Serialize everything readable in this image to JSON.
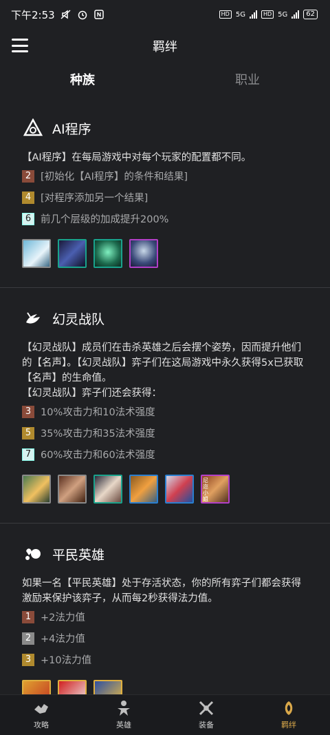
{
  "status": {
    "time": "下午2:53",
    "net1": "5G",
    "net2": "5G",
    "hd": "HD",
    "battery": "62"
  },
  "appbar": {
    "title": "羁绊"
  },
  "tabs": [
    {
      "label": "种族",
      "active": true
    },
    {
      "label": "职业",
      "active": false
    }
  ],
  "sections": [
    {
      "title": "AI程序",
      "desc": "【AI程序】在每局游戏中对每个玩家的配置都不同。",
      "tiers": [
        {
          "n": "2",
          "text": "[初始化【AI程序】的条件和结果]"
        },
        {
          "n": "4",
          "text": "[对程序添加另一个结果]"
        },
        {
          "n": "6",
          "text": "前几个层级的加成提升200%"
        }
      ],
      "champs": [
        "c1",
        "c2",
        "c2",
        "c4"
      ]
    },
    {
      "title": "幻灵战队",
      "desc": "【幻灵战队】成员们在击杀英雄之后会摆个姿势，因而提升他们的【名声】。【幻灵战队】弈子们在这局游戏中永久获得5x已获取【名声】的生命值。",
      "desc2": "【幻灵战队】弈子们还会获得：",
      "tiers": [
        {
          "n": "3",
          "text": "10%攻击力和10法术强度"
        },
        {
          "n": "5",
          "text": "35%攻击力和35法术强度"
        },
        {
          "n": "7",
          "text": "60%攻击力和60法术强度"
        }
      ],
      "champs": [
        "c1",
        "c1",
        "c2",
        "c3",
        "c3",
        "c4"
      ],
      "champ_label": "尼迩小姐"
    },
    {
      "title": "平民英雄",
      "desc": "如果一名【平民英雄】处于存活状态，你的所有弈子们都会获得激励来保护该弈子，从而每2秒获得法力值。",
      "tiers": [
        {
          "n": "1",
          "text": "+2法力值"
        },
        {
          "n": "2",
          "text": "+4法力值"
        },
        {
          "n": "3",
          "text": "+10法力值"
        }
      ],
      "champs": [
        "c5",
        "c5",
        "c5"
      ]
    }
  ],
  "nav": [
    {
      "label": "攻略",
      "icon": "strategy-icon",
      "active": false
    },
    {
      "label": "英雄",
      "icon": "hero-icon",
      "active": false
    },
    {
      "label": "装备",
      "icon": "equipment-icon",
      "active": false
    },
    {
      "label": "羁绊",
      "icon": "traits-icon",
      "active": true
    }
  ],
  "colors": {
    "background": "#1f2023",
    "accent": "#d9a84a",
    "bronze": "#8a4b3a",
    "silver": "#8a8a8a",
    "gold": "#b08a2e",
    "prismatic": "#d6f3f1"
  }
}
